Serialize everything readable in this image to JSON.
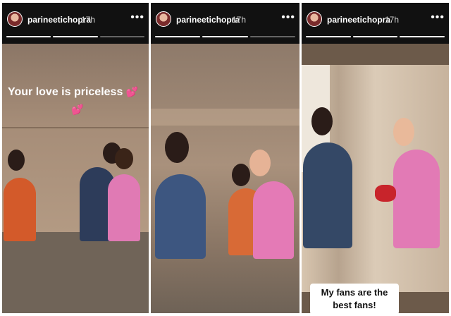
{
  "stories": [
    {
      "username": "parineetichopra",
      "time": "17h",
      "more": "•••",
      "caption": "Your love is priceless"
    },
    {
      "username": "parineetichopra",
      "time": "17h",
      "more": "•••"
    },
    {
      "username": "parineetichopra",
      "time": "17h",
      "more": "•••",
      "caption": "My fans are the best fans!"
    }
  ],
  "heart_glyph": "💕",
  "colors": {
    "header_bg": "#111111",
    "caption_bg": "#ffffff",
    "heart": "#f067b4"
  }
}
